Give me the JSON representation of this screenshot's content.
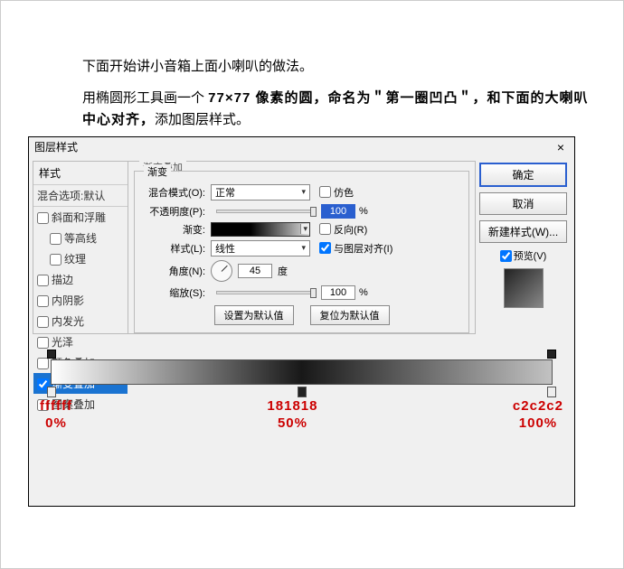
{
  "intro": {
    "line1": "下面开始讲小音箱上面小喇叭的做法。",
    "line2_pre": "用椭圆形工具画一个 ",
    "line2_b": "77×77 像素的圆，命名为＂第一圈凹凸＂，和下面的大喇叭中心对齐，",
    "line2_post": "添加图层样式。"
  },
  "dialog": {
    "title": "图层样式",
    "close": "×",
    "sidebar": {
      "header": "样式",
      "blend_default": "混合选项:默认",
      "items": [
        {
          "label": "斜面和浮雕",
          "checked": false
        },
        {
          "label": "等高线",
          "checked": false,
          "sub": true
        },
        {
          "label": "纹理",
          "checked": false,
          "sub": true
        },
        {
          "label": "描边",
          "checked": false
        },
        {
          "label": "内阴影",
          "checked": false
        },
        {
          "label": "内发光",
          "checked": false
        },
        {
          "label": "光泽",
          "checked": false
        },
        {
          "label": "颜色叠加",
          "checked": false
        },
        {
          "label": "渐变叠加",
          "checked": true,
          "active": true
        },
        {
          "label": "图案叠加",
          "checked": false
        }
      ]
    },
    "panel": {
      "group_title": "渐变叠加",
      "fieldset_title": "渐变",
      "blend_mode_label": "混合模式(O):",
      "blend_mode_value": "正常",
      "dither_label": "仿色",
      "opacity_label": "不透明度(P):",
      "opacity_value": "100",
      "percent": "%",
      "gradient_label": "渐变:",
      "reverse_label": "反向(R)",
      "style_label": "样式(L):",
      "style_value": "线性",
      "align_label": "与图层对齐(I)",
      "angle_label": "角度(N):",
      "angle_value": "45",
      "angle_unit": "度",
      "scale_label": "缩放(S):",
      "scale_value": "100",
      "set_default": "设置为默认值",
      "reset_default": "复位为默认值"
    },
    "right": {
      "ok": "确定",
      "cancel": "取消",
      "new_style": "新建样式(W)...",
      "preview": "预览(V)"
    }
  },
  "stops": [
    {
      "hex": "ffffff",
      "pct": "0%"
    },
    {
      "hex": "181818",
      "pct": "50%"
    },
    {
      "hex": "c2c2c2",
      "pct": "100%"
    }
  ]
}
